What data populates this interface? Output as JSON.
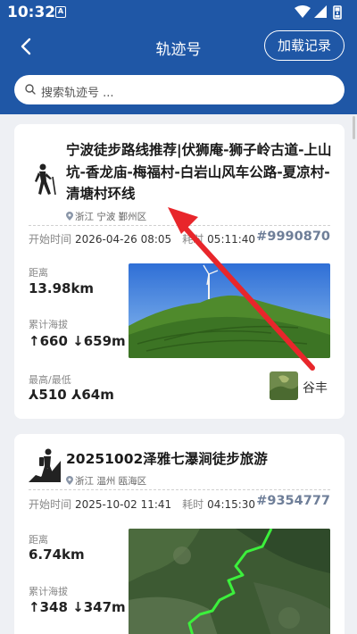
{
  "status_bar": {
    "time": "10:32",
    "a_badge": "A"
  },
  "app_bar": {
    "title": "轨迹号",
    "load_button": "加载记录",
    "back_icon": "back-arrow-icon"
  },
  "search": {
    "placeholder": "搜索轨迹号 ..."
  },
  "cards": [
    {
      "title": "宁波徒步路线推荐|伏狮庵-狮子岭古道-上山坑-香龙庙-梅福村-白岩山风车公路-夏凉村-清塘村环线",
      "location": "浙江 宁波 鄞州区",
      "start_label": "开始时间",
      "start_time": "2026-04-26 08:05",
      "duration_label": "耗时",
      "duration": "05:11:40",
      "track_id": "#9990870",
      "distance_label": "距离",
      "distance": "13.98km",
      "elevation_label": "累计海拔",
      "elevation_up": "↑660",
      "elevation_down": "↓659m",
      "hilo_label": "最高/最低",
      "high": "⅄510",
      "low": "⅄64m",
      "user": "谷丰",
      "photo": "tea-hill-wind-turbine"
    },
    {
      "title": "20251002泽雅七瀑涧徒步旅游",
      "location": "浙江 温州 瓯海区",
      "start_label": "开始时间",
      "start_time": "2025-10-02 11:41",
      "duration_label": "耗时",
      "duration": "04:15:30",
      "track_id": "#9354777",
      "distance_label": "距离",
      "distance": "6.74km",
      "elevation_label": "累计海拔",
      "elevation_up": "↑348",
      "elevation_down": "↓347m",
      "photo": "satellite-track-map"
    }
  ],
  "colors": {
    "header": "#1f57a6",
    "track_id": "#6e7e98",
    "annotation_arrow": "#e8262b"
  }
}
